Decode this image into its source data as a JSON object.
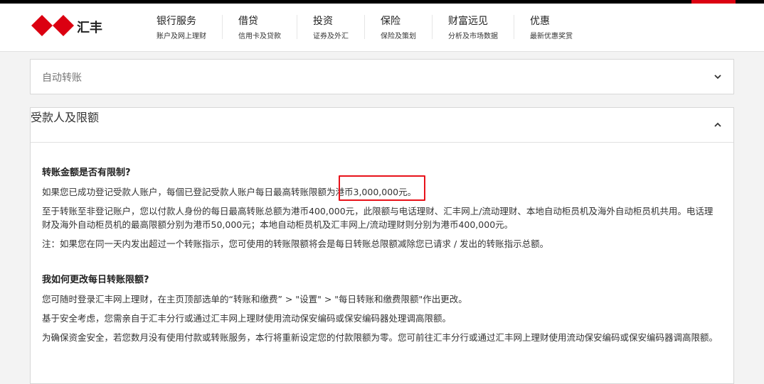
{
  "header": {
    "brand": "汇丰",
    "nav": [
      {
        "title": "银行服务",
        "sub": "账户及网上理财"
      },
      {
        "title": "借贷",
        "sub": "信用卡及贷款"
      },
      {
        "title": "投资",
        "sub": "证券及外汇"
      },
      {
        "title": "保险",
        "sub": "保险及策划"
      },
      {
        "title": "财富远见",
        "sub": "分析及市场数据"
      },
      {
        "title": "优惠",
        "sub": "最新优惠奖赏"
      }
    ]
  },
  "accordion": [
    {
      "label": "自动转账",
      "state": "collapsed",
      "icon": "chevron-down-icon"
    },
    {
      "label": "受款人及限额",
      "state": "expanded",
      "icon": "chevron-up-icon"
    }
  ],
  "content": {
    "q1": "转账金额是否有限制?",
    "p1": "如果您已成功登记受款人账户，每個已登記受款人账户每日最高转账限额为港币3,000,000元。",
    "p2": "至于转账至非登记账户，您以付款人身份的每日最高转账总额为港币400,000元，此限额与电话理财、汇丰网上/流动理财、本地自动柜员机及海外自动柜员机共用。电话理财及海外自动柜员机的最高限额分别为港币50,000元；本地自动柜员机及汇丰网上/流动理财则分别为港币400,000元。",
    "p3": "注：如果您在同一天内发出超过一个转账指示，您可使用的转账限额将会是每日转账总限额减除您已请求 / 发出的转账指示总额。",
    "q2": "我如何更改每日转账限额?",
    "p4": "您可随时登录汇丰网上理财，在主页顶部选单的“转账和缴费” > \"设置\" > \"每日转账和缴费限额\"作出更改。",
    "p5": "基于安全考虑，您需亲自于汇丰分行或通过汇丰网上理财使用流动保安编码或保安编码器处理调高限额。",
    "p6": "为确保资金安全，若您数月没有使用付款或转账服务，本行将重新设定您的付款限额为零。您可前往汇丰分行或通过汇丰网上理财使用流动保安编码或保安编码器调高限额。"
  },
  "colors": {
    "brand_red": "#db0011",
    "highlight": "#e8121a"
  }
}
